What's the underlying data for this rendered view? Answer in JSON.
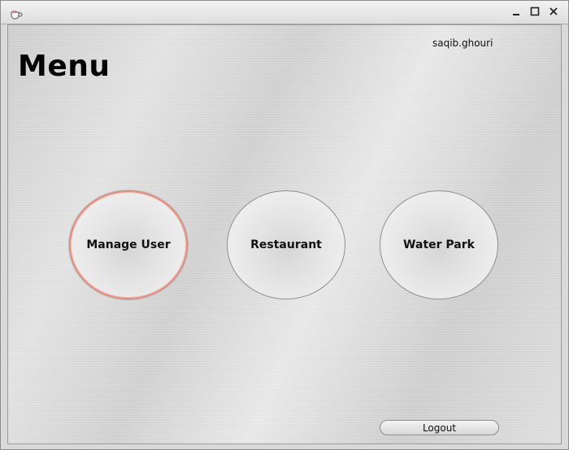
{
  "window": {
    "icon": "coffee-cup-icon",
    "controls": {
      "minimize": "minimize-icon",
      "maximize": "maximize-icon",
      "close": "close-icon"
    }
  },
  "header": {
    "username": "saqib.ghouri",
    "title": "Menu"
  },
  "menu": {
    "buttons": [
      {
        "label": "Manage User"
      },
      {
        "label": "Restaurant"
      },
      {
        "label": "Water Park"
      }
    ]
  },
  "footer": {
    "logout_label": "Logout"
  },
  "colors": {
    "focus_ring": "#e48e80",
    "title_text": "#050505"
  }
}
